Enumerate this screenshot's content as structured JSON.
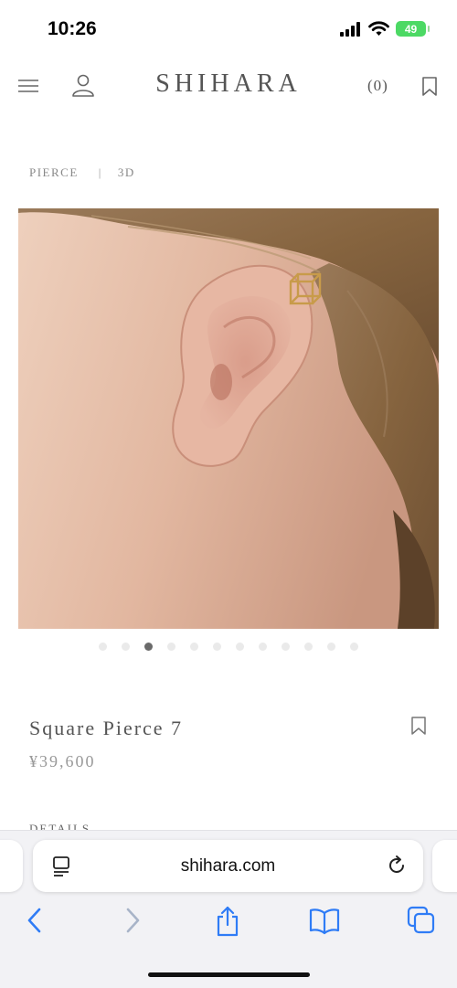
{
  "status": {
    "time": "10:26",
    "battery": "49"
  },
  "header": {
    "logo": "SHIHARA",
    "cart_count": "(0)"
  },
  "breadcrumb": {
    "category": "PIERCE",
    "separator": "|",
    "collection": "3D"
  },
  "carousel": {
    "total_dots": 12,
    "active_index": 2
  },
  "product": {
    "name": "Square Pierce 7",
    "price": "¥39,600",
    "details_label": "DETAILS"
  },
  "browser": {
    "url": "shihara.com"
  },
  "colors": {
    "accent_battery": "#4cd964",
    "ios_blue": "#2f7cf6",
    "text_gray": "#555555"
  },
  "icons": {
    "menu": "menu-icon",
    "account": "user-icon",
    "bookmark": "bookmark-icon",
    "reader": "reader-icon",
    "reload": "reload-icon",
    "back": "chevron-left-icon",
    "forward": "chevron-right-icon",
    "share": "share-icon",
    "bookmarks": "book-icon",
    "tabs": "tabs-icon"
  }
}
